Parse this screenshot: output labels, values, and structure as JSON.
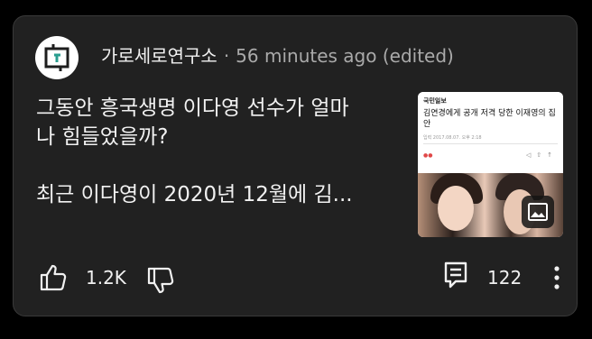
{
  "post": {
    "channel_name": "가로세로연구소",
    "separator": "·",
    "timestamp": "56 minutes ago (edited)",
    "text_line1": "그동안 흥국생명 이다영 선수가 얼마",
    "text_line2": "나 힘들었을까?",
    "text_line3": "최근 이다영이 2020년 12월에 김..."
  },
  "thumbnail": {
    "news_brand": "국민일보",
    "news_title": "김연경에게 공개 저격 당한 이재영의 집안",
    "news_date": "입력 2017.08.07. 오후 2:18",
    "image_icon": "image-icon"
  },
  "actions": {
    "like_count": "1.2K",
    "comment_count": "122",
    "icons": [
      "thumb-up-icon",
      "thumb-down-icon",
      "comment-icon",
      "more-vert-icon"
    ]
  },
  "colors": {
    "background": "#000000",
    "card": "#212121",
    "text_primary": "#f1f1f1",
    "text_secondary": "#aaaaaa"
  }
}
